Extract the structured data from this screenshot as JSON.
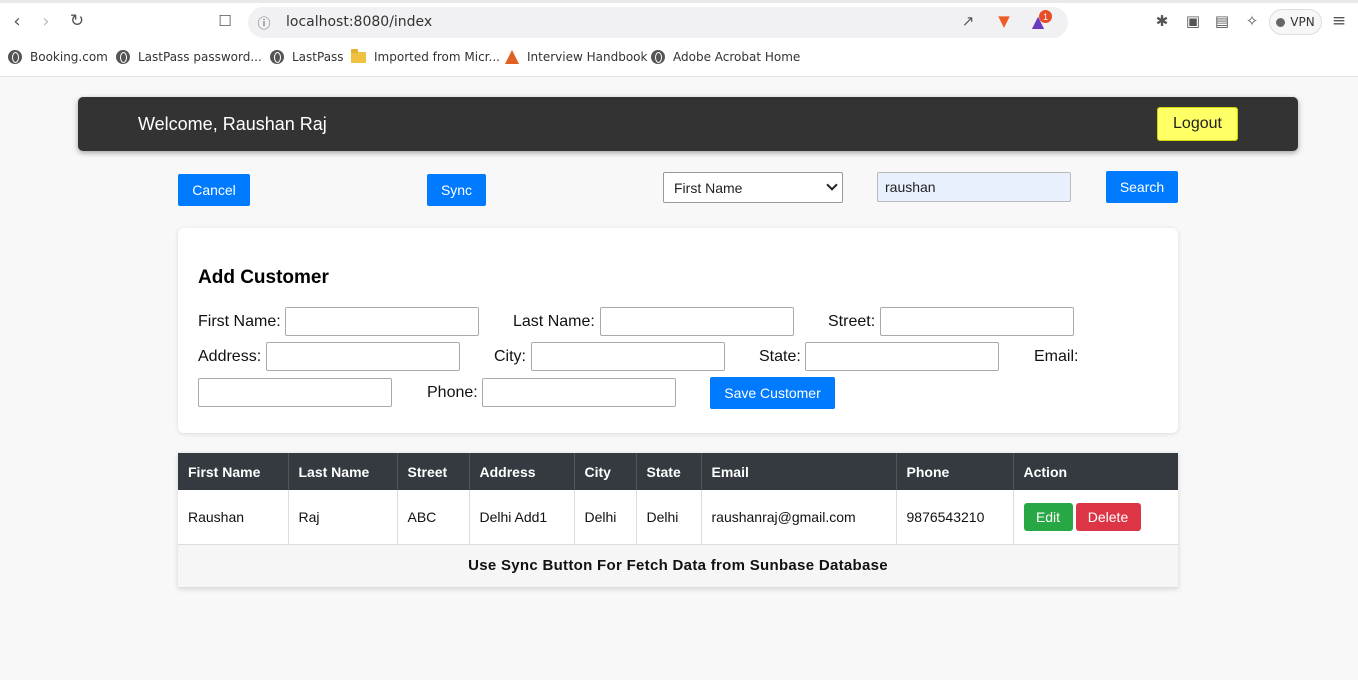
{
  "browser": {
    "url": "localhost:8080/index",
    "notification_count": "1",
    "vpn_label": "VPN",
    "bookmarks": [
      {
        "label": "Booking.com",
        "icon": "globe-icon"
      },
      {
        "label": "LastPass password...",
        "icon": "globe-icon"
      },
      {
        "label": "LastPass",
        "icon": "globe-icon"
      },
      {
        "label": "Imported from Micr...",
        "icon": "folder-icon"
      },
      {
        "label": "Interview Handbook",
        "icon": "flask-icon"
      },
      {
        "label": "Adobe Acrobat Home",
        "icon": "globe-icon"
      }
    ]
  },
  "header": {
    "welcome": "Welcome, Raushan Raj",
    "logout_label": "Logout"
  },
  "toolbar": {
    "cancel_label": "Cancel",
    "sync_label": "Sync",
    "search_field_selected": "First Name",
    "search_value": "raushan",
    "search_label": "Search"
  },
  "add_customer": {
    "title": "Add Customer",
    "labels": {
      "first_name": "First Name:",
      "last_name": "Last Name:",
      "street": "Street:",
      "address": "Address:",
      "city": "City:",
      "state": "State:",
      "email": "Email:",
      "phone": "Phone:"
    },
    "save_label": "Save Customer"
  },
  "table": {
    "headers": [
      "First Name",
      "Last Name",
      "Street",
      "Address",
      "City",
      "State",
      "Email",
      "Phone",
      "Action"
    ],
    "rows": [
      [
        "Raushan",
        "Raj",
        "ABC",
        "Delhi Add1",
        "Delhi",
        "Delhi",
        "raushanraj@gmail.com",
        "9876543210"
      ]
    ],
    "edit_label": "Edit",
    "delete_label": "Delete",
    "footer_note": "Use Sync Button For Fetch Data from Sunbase Database"
  },
  "colors": {
    "primary": "#007bff",
    "header_bg": "#333333",
    "logout_bg": "#ffff66",
    "edit": "#28a745",
    "delete": "#dc3545",
    "table_head": "#343a40"
  }
}
